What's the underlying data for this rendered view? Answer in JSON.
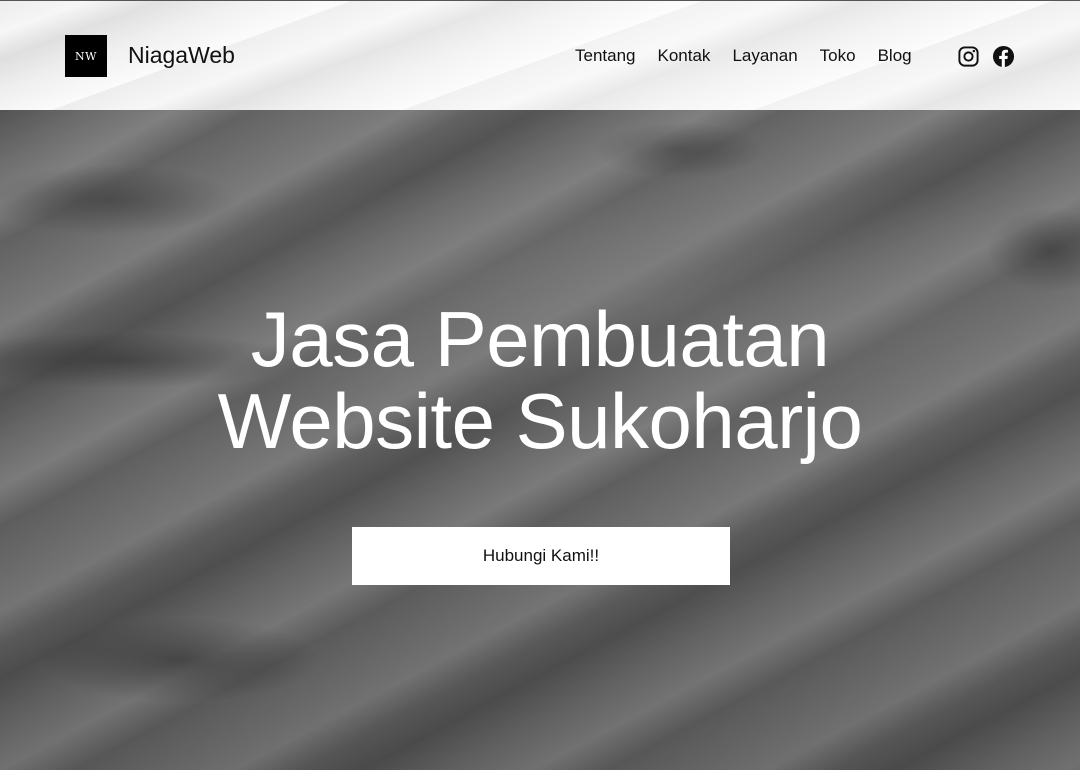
{
  "header": {
    "logo_text": "NW",
    "site_title": "NiagaWeb",
    "nav": [
      {
        "label": "Tentang"
      },
      {
        "label": "Kontak"
      },
      {
        "label": "Layanan"
      },
      {
        "label": "Toko"
      },
      {
        "label": "Blog"
      }
    ],
    "social": [
      {
        "icon": "instagram-icon"
      },
      {
        "icon": "facebook-icon"
      }
    ]
  },
  "hero": {
    "title_line1": "Jasa Pembuatan",
    "title_line2": "Website Sukoharjo",
    "cta_label": "Hubungi Kami!!"
  },
  "colors": {
    "header_bg": "#ededed",
    "hero_overlay": "#717171",
    "text_dark": "#111111",
    "text_light": "#ffffff",
    "logo_bg": "#000000",
    "button_bg": "#ffffff"
  }
}
